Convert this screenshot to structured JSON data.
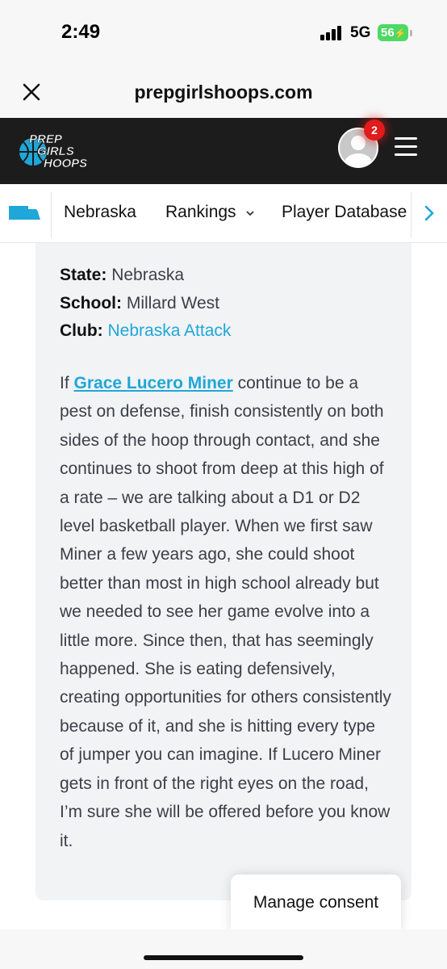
{
  "status_bar": {
    "time": "2:49",
    "network": "5G",
    "battery": "56"
  },
  "browser": {
    "url": "prepgirlshoops.com",
    "close_icon": "close-icon"
  },
  "site_header": {
    "logo_lines": [
      "PREP",
      "GIRLS",
      "HOOPS"
    ],
    "notification_count": "2",
    "menu_icon": "hamburger-icon",
    "colors": {
      "header_bg": "#1c1c1c",
      "logo_blue": "#1ea7d8",
      "badge_red": "#e21b1b"
    }
  },
  "nav": {
    "state": "Nebraska",
    "rankings": "Rankings",
    "rankings_icon": "chevron-down-icon",
    "player_database": "Player Database",
    "scroll_icon": "chevron-right-icon"
  },
  "profile": {
    "state_label": "State:",
    "state_value": "Nebraska",
    "school_label": "School:",
    "school_value": "Millard West",
    "club_label": "Club:",
    "club_value": "Nebraska Attack"
  },
  "article": {
    "intro": "If",
    "player_name": "Grace Lucero Miner",
    "body": "continue to be a pest on defense, finish consistently on both sides of the hoop through contact, and she continues to shoot from deep at this high of a rate – we are talking about a D1 or D2 level basketball player. When we first saw Miner a few years ago, she could shoot better than most in high school already but we needed to see her game evolve into a little more. Since then, that has seemingly happened. She is eating defensively, creating opportunities for others consistently because of it, and she is hitting every type of jumper you can imagine. If Lucero Miner gets in front of the right eyes on the road, I’m sure she will be offered before you know it."
  },
  "consent": {
    "label": "Manage consent"
  }
}
